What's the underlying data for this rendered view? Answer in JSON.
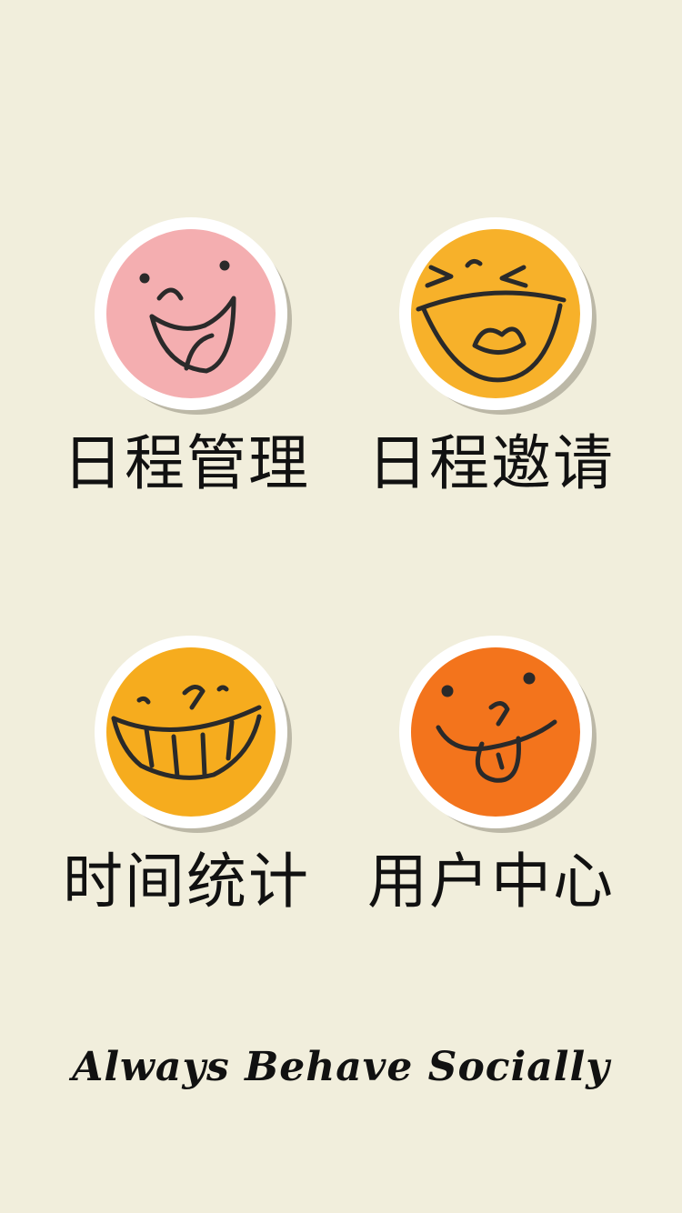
{
  "menu": {
    "items": [
      {
        "label": "日程管理",
        "icon": "laughing-pink-face-icon",
        "color": "#f4aeb0"
      },
      {
        "label": "日程邀请",
        "icon": "grinning-yellow-face-icon",
        "color": "#f7b12a"
      },
      {
        "label": "时间统计",
        "icon": "toothy-grin-face-icon",
        "color": "#f6ac1e"
      },
      {
        "label": "用户中心",
        "icon": "tongue-out-face-icon",
        "color": "#f3741c"
      }
    ]
  },
  "slogan": "Always Behave Socially",
  "colors": {
    "background": "#f1eedc",
    "badge_rim": "#ffffff",
    "badge_shadow": "#8f8c7c",
    "ink": "#2a2a2a"
  }
}
